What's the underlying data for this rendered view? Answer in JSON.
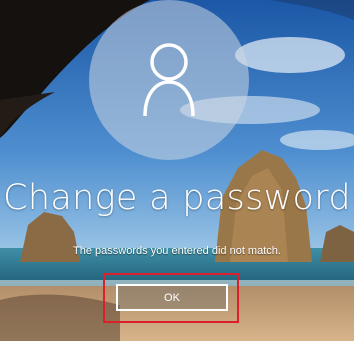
{
  "screen": {
    "title": "Change a password",
    "message": "The passwords you entered did not match."
  },
  "avatar": {
    "icon": "user-icon"
  },
  "actions": {
    "ok_label": "OK"
  },
  "colors": {
    "sky_top": "#1d5aa8",
    "sky_mid": "#6fa9d6",
    "sea": "#2a6f86",
    "sand": "#c9a27a",
    "highlight_border": "#dc1e2d",
    "text": "#ffffff"
  }
}
